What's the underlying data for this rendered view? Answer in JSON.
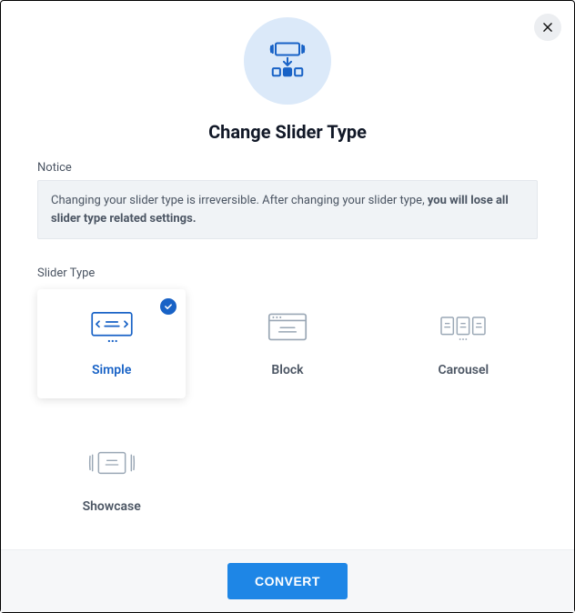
{
  "dialog": {
    "title": "Change Slider Type",
    "notice_label": "Notice",
    "notice_text_part1": "Changing your slider type is irreversible. After changing your slider type, ",
    "notice_text_bold": "you will lose all slider type related settings.",
    "slider_type_label": "Slider Type",
    "convert_label": "CONVERT"
  },
  "options": {
    "simple": {
      "label": "Simple",
      "selected": true
    },
    "block": {
      "label": "Block",
      "selected": false
    },
    "carousel": {
      "label": "Carousel",
      "selected": false
    },
    "showcase": {
      "label": "Showcase",
      "selected": false
    }
  }
}
